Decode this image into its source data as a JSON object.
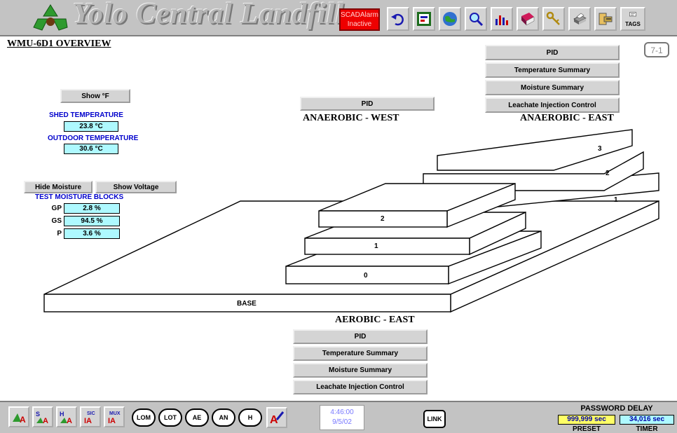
{
  "header": {
    "app_title": "Yolo Central Landfill",
    "scada_alarm": {
      "line1": "SCADAlarm",
      "line2": "Inactive"
    },
    "toolbar_icons": [
      "undo-icon",
      "dashboard-icon",
      "globe-icon",
      "magnifier-icon",
      "bar-chart-icon",
      "book-icon",
      "keys-icon",
      "printer-icon",
      "exit-icon",
      "tags-icon"
    ],
    "tags_label": "TAGS"
  },
  "page": {
    "title": "WMU-6D1 OVERVIEW",
    "number": "7-1"
  },
  "east_panel": {
    "pid": "PID",
    "temperature_summary": "Temperature Summary",
    "moisture_summary": "Moisture Summary",
    "leachate": "Leachate Injection Control",
    "label": "ANAEROBIC - EAST"
  },
  "west_panel": {
    "pid": "PID",
    "label": "ANAEROBIC - WEST"
  },
  "aerobic_panel": {
    "label": "AEROBIC - EAST",
    "pid": "PID",
    "temperature_summary": "Temperature Summary",
    "moisture_summary": "Moisture Summary",
    "leachate": "Leachate Injection Control"
  },
  "temperatures": {
    "show_f": "Show °F",
    "shed_label": "SHED TEMPERATURE",
    "shed_value": "23.8 °C",
    "outdoor_label": "OUTDOOR TEMPERATURE",
    "outdoor_value": "30.6 °C"
  },
  "moisture": {
    "hide_moisture": "Hide Moisture",
    "show_voltage": "Show Voltage",
    "title": "TEST MOISTURE BLOCKS",
    "rows": [
      {
        "label": "GP",
        "value": "2.8 %"
      },
      {
        "label": "GS",
        "value": "94.5 %"
      },
      {
        "label": "P",
        "value": "3.6 %"
      }
    ]
  },
  "layers": {
    "base": "BASE",
    "west": [
      "0",
      "1",
      "2"
    ],
    "east": [
      "1",
      "2",
      "3"
    ]
  },
  "footer": {
    "icons": [
      "alarm-summary-icon",
      "sa-alarm-icon",
      "ha-alarm-icon",
      "sic-ia-icon",
      "mux-ia-icon"
    ],
    "ovals": [
      "LOM",
      "LOT",
      "AE",
      "AN",
      "H"
    ],
    "clock_time": "4:46:00",
    "clock_date": "9/5/02",
    "link": "LINK",
    "password_delay": "PASSWORD DELAY",
    "preset_value": "999,999 sec",
    "timer_value": "34,016 sec",
    "preset_label": "PRESET",
    "timer_label": "TIMER"
  },
  "colors": {
    "background": "#ffffff",
    "chrome": "#c3c3c3",
    "alarm_red": "#ee0000",
    "value_cyan": "#aef9ff",
    "label_blue": "#0000cc",
    "preset_yellow": "#ffff66"
  }
}
